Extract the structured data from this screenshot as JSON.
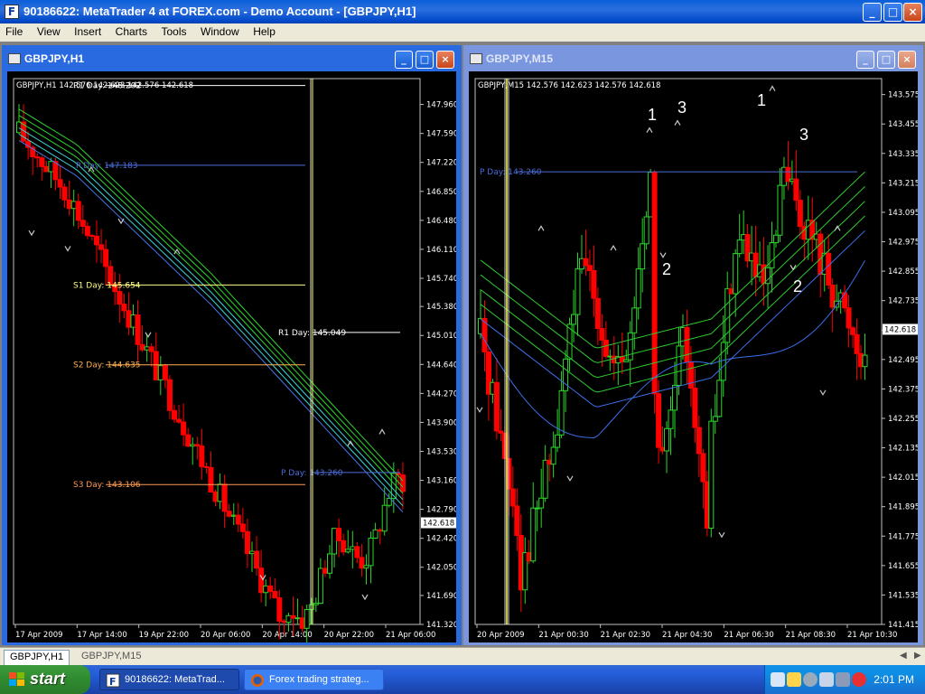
{
  "window": {
    "title": "90186622: MetaTrader 4 at FOREX.com - Demo Account - [GBPJPY,H1]",
    "app_icon": "F",
    "buttons": {
      "min": "_",
      "max": "□",
      "close": "×"
    }
  },
  "menu": [
    "File",
    "View",
    "Insert",
    "Charts",
    "Tools",
    "Window",
    "Help"
  ],
  "charts": {
    "h1": {
      "title": "GBPJPY,H1",
      "info": "GBPJPY,H1  142.576 142.623 142.576 142.618",
      "price_axis": [
        "147.960",
        "147.590",
        "147.220",
        "146.850",
        "146.480",
        "146.110",
        "145.740",
        "145.380",
        "145.010",
        "144.640",
        "144.270",
        "143.900",
        "143.530",
        "143.160",
        "142.790",
        "142.420",
        "142.050",
        "141.690",
        "141.320"
      ],
      "price_range": [
        141.32,
        148.29
      ],
      "current_price": "142.618",
      "current_value": 142.618,
      "time_axis": [
        "17 Apr 2009",
        "17 Apr 14:00",
        "19 Apr 22:00",
        "20 Apr 06:00",
        "20 Apr 14:00",
        "20 Apr 22:00",
        "21 Apr 06:00"
      ],
      "pivots": [
        {
          "label": "R1 Day: 148.202",
          "value": 148.202,
          "color": "#ffffff"
        },
        {
          "label": "P Day: 147.183",
          "value": 147.183,
          "color": "#4a6cd8"
        },
        {
          "label": "S1 Day: 145.654",
          "value": 145.654,
          "color": "#ffff80"
        },
        {
          "label": "R1 Day: 145.049",
          "value": 145.049,
          "color": "#ffffff"
        },
        {
          "label": "S2 Day: 144.635",
          "value": 144.635,
          "color": "#ffb050"
        },
        {
          "label": "P Day: 143.260",
          "value": 143.26,
          "color": "#4a6cd8"
        },
        {
          "label": "S3 Day: 143.106",
          "value": 143.106,
          "color": "#ff9a50"
        }
      ]
    },
    "m15": {
      "title": "GBPJPY,M15",
      "info": "GBPJPY,M15  142.576 142.623 142.576 142.618",
      "price_axis": [
        "143.575",
        "143.455",
        "143.335",
        "143.215",
        "143.095",
        "142.975",
        "142.855",
        "142.735",
        "142.615",
        "142.495",
        "142.375",
        "142.255",
        "142.135",
        "142.015",
        "141.895",
        "141.775",
        "141.655",
        "141.535",
        "141.415"
      ],
      "price_range": [
        141.415,
        143.64
      ],
      "current_price": "142.618",
      "current_value": 142.618,
      "time_axis": [
        "20 Apr 2009",
        "21 Apr 00:30",
        "21 Apr 02:30",
        "21 Apr 04:30",
        "21 Apr 06:30",
        "21 Apr 08:30",
        "21 Apr 10:30"
      ],
      "pivots": [
        {
          "label": "P Day: 143.260",
          "value": 143.26,
          "color": "#4a6cd8"
        }
      ],
      "annotations": [
        "1",
        "3",
        "2",
        "1",
        "3",
        "2"
      ]
    }
  },
  "tabs": [
    "GBPJPY,H1",
    "GBPJPY,M15"
  ],
  "taskbar": {
    "start": "start",
    "tasks": [
      "90186622: MetaTrad...",
      "Forex trading strateg..."
    ],
    "clock": "2:01 PM"
  },
  "colors": {
    "bull": "#2bd62b",
    "bear": "#ff0000",
    "ma_green": "#2fcc2f",
    "ma_blue": "#3b6ee8"
  }
}
